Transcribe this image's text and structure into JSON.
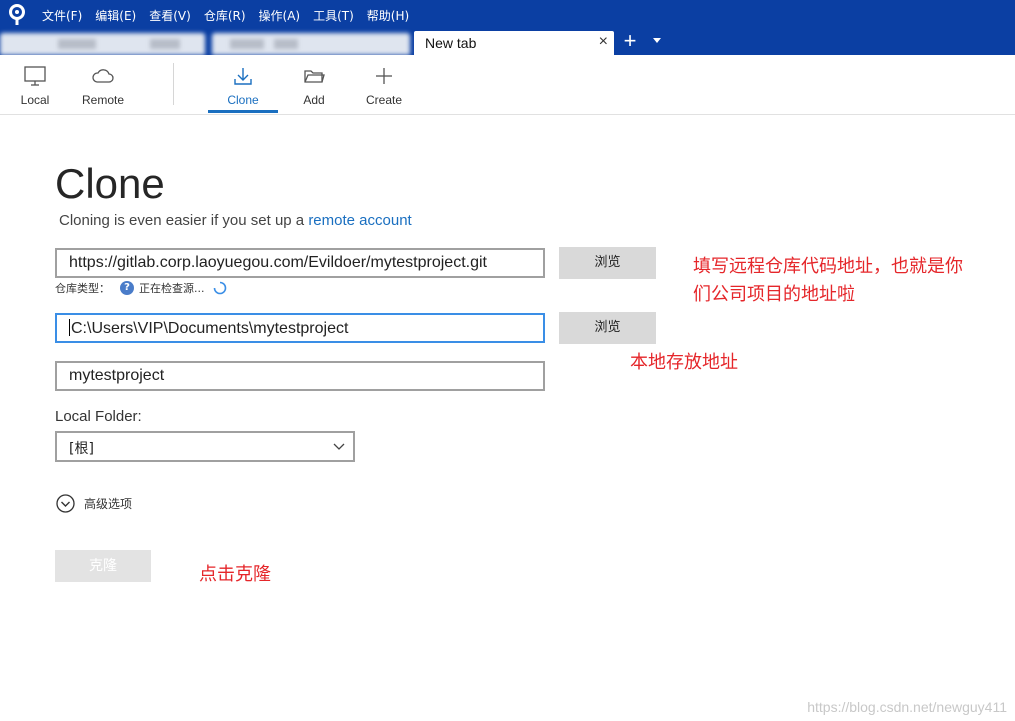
{
  "menu": {
    "items": [
      "文件(F)",
      "编辑(E)",
      "查看(V)",
      "仓库(R)",
      "操作(A)",
      "工具(T)",
      "帮助(H)"
    ]
  },
  "tabs": {
    "active_title": "New tab",
    "close_glyph": "×",
    "add_glyph": "+"
  },
  "toolbar": {
    "local": "Local",
    "remote": "Remote",
    "clone": "Clone",
    "add": "Add",
    "create": "Create"
  },
  "clone": {
    "title": "Clone",
    "subtitle_prefix": "Cloning is even easier if you set up a ",
    "subtitle_link": "remote account",
    "url_value": "https://gitlab.corp.laoyuegou.com/Evildoer/mytestproject.git",
    "browse_label": "浏览",
    "repo_type_label": "仓库类型：",
    "repo_type_status": "正在检查源...",
    "path_value": "C:\\Users\\VIP\\Documents\\mytestproject",
    "name_value": "mytestproject",
    "local_folder_label": "Local Folder:",
    "local_folder_value": "[根]",
    "advanced_label": "高级选项",
    "clone_button": "克隆"
  },
  "annotations": {
    "remote_line1": "填写远程仓库代码地址，也就是你",
    "remote_line2": "们公司项目的地址啦",
    "local_path": "本地存放地址",
    "click_clone": "点击克隆"
  },
  "watermark": "https://blog.csdn.net/newguy411",
  "colors": {
    "titlebar": "#0b3fa3",
    "accent": "#1a6fc0",
    "annotation": "#e5262a"
  },
  "icons": [
    "app-logo-icon",
    "monitor-icon",
    "cloud-icon",
    "download-icon",
    "folder-icon",
    "plus-icon",
    "question-icon",
    "spinner-icon",
    "chevron-down-icon",
    "expand-circle-icon"
  ]
}
